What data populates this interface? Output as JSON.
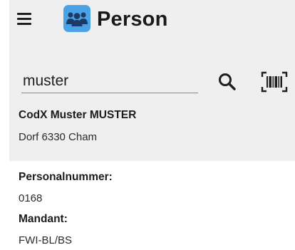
{
  "header": {
    "title": "Person",
    "menu_icon": "hamburger-menu-icon",
    "app_icon": "people-group-icon"
  },
  "search": {
    "value": "muster",
    "search_icon": "search-icon",
    "scan_icon": "barcode-scan-icon"
  },
  "result": {
    "name": "CodX Muster MUSTER",
    "address": "Dorf 6330 Cham"
  },
  "details": [
    {
      "label": "Personalnummer:",
      "value": "0168"
    },
    {
      "label": "Mandant:",
      "value": "FWI-BL/BS"
    }
  ],
  "colors": {
    "panel_background": "#efefef",
    "app_icon_background": "#4aa3e6",
    "app_icon_figures": "#1e3a66"
  }
}
